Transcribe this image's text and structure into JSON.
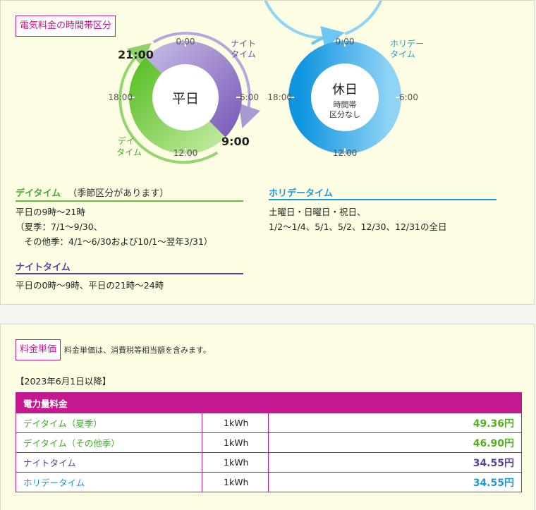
{
  "section_title": "電気料金の時間帯区分",
  "weekday_dial": {
    "center_label": "平日",
    "tick_0": "0:00",
    "tick_6": "6:00",
    "tick_12": "12:00",
    "tick_18": "18:00",
    "big_21": "21:00",
    "big_9": "9:00",
    "night_label_1": "ナイト",
    "night_label_2": "タイム",
    "day_label_1": "デイ",
    "day_label_2": "タイム"
  },
  "holiday_dial": {
    "center_label": "休日",
    "center_sub_1": "時間帯",
    "center_sub_2": "区分なし",
    "tick_0": "0:00",
    "tick_6": "6:00",
    "tick_12": "12:00",
    "tick_18": "18:00",
    "label_1": "ホリデー",
    "label_2": "タイム"
  },
  "legend": {
    "day_title": "デイタイム",
    "day_note": "（季節区分があります）",
    "day_text": "平日の9時～21時\n（夏季：7/1～9/30、\n　その他季：4/1～6/30および10/1～翌年3/31）",
    "night_title": "ナイトタイム",
    "night_text": "平日の0時～9時、平日の21時～24時",
    "holiday_title": "ホリデータイム",
    "holiday_text": "土曜日・日曜日・祝日、\n1/2～1/4、5/1、5/2、12/30、12/31の全日"
  },
  "price": {
    "tag": "料金単価",
    "note": "料金単価は、消費税等相当額を含みます。",
    "effective_date": "【2023年6月1日以降】",
    "table_header": "電力量料金",
    "rows": [
      {
        "name": "デイタイム（夏季）",
        "unit": "1kWh",
        "price": "49.36円"
      },
      {
        "name": "デイタイム（その他季）",
        "unit": "1kWh",
        "price": "46.90円"
      },
      {
        "name": "ナイトタイム",
        "unit": "1kWh",
        "price": "34.55円"
      },
      {
        "name": "ホリデータイム",
        "unit": "1kWh",
        "price": "34.55円"
      }
    ]
  },
  "colors": {
    "magenta": "#c4188e",
    "day_green": "#5cc432",
    "night_purple": "#7b5cb8",
    "holiday_blue": "#1c9ad6"
  }
}
